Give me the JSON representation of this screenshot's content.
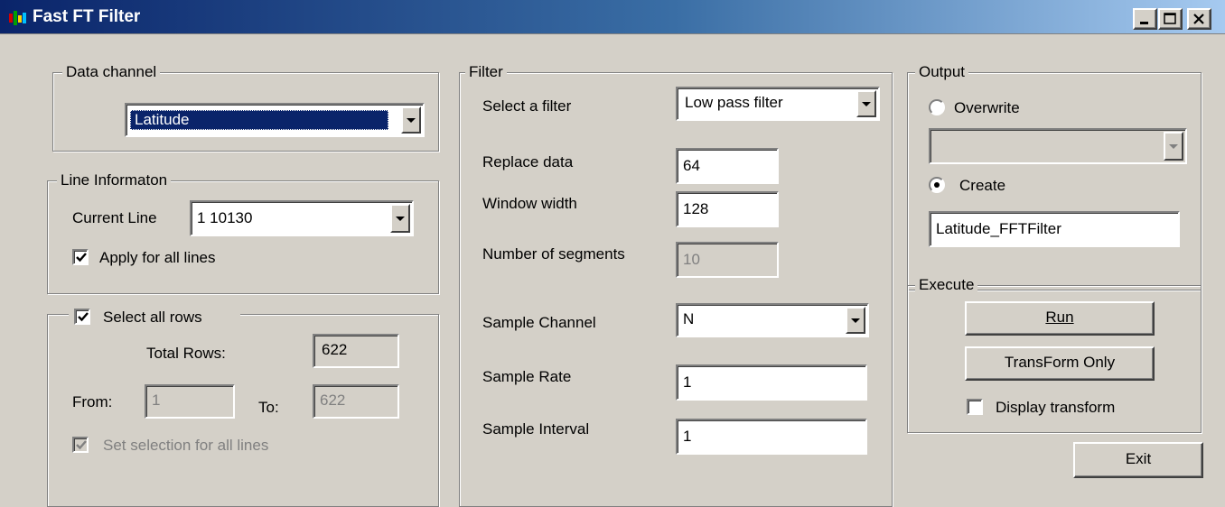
{
  "window": {
    "title": "Fast FT Filter"
  },
  "data_channel": {
    "legend": "Data channel",
    "selected": "Latitude"
  },
  "line_info": {
    "legend": "Line Informaton",
    "current_line_label": "Current Line",
    "current_line_value": "1  10130",
    "apply_all_label": "Apply for all lines"
  },
  "rows": {
    "select_all_label": "Select all rows",
    "total_rows_label": "Total Rows:",
    "total_rows_value": "622",
    "from_label": "From:",
    "from_value": "1",
    "to_label": "To:",
    "to_value": "622",
    "set_selection_label": "Set selection for all lines"
  },
  "filter": {
    "legend": "Filter",
    "select_label": "Select a filter",
    "select_value": "Low pass filter",
    "replace_label": "Replace data",
    "replace_value": "64",
    "window_label": "Window width",
    "window_value": "128",
    "segments_label": "Number of segments",
    "segments_value": "10",
    "sample_channel_label": "Sample Channel",
    "sample_channel_value": "N",
    "sample_rate_label": "Sample Rate",
    "sample_rate_value": "1",
    "sample_interval_label": "Sample Interval",
    "sample_interval_value": "1"
  },
  "output": {
    "legend": "Output",
    "overwrite_label": "Overwrite",
    "overwrite_selected_value": "",
    "create_label": "Create",
    "create_value": "Latitude_FFTFilter",
    "selected_option": "Create"
  },
  "execute": {
    "legend": "Execute",
    "run_label": "Run",
    "transform_label": "TransForm Only",
    "display_label": "Display transform"
  },
  "exit_label": "Exit",
  "states": {
    "apply_all_checked": true,
    "select_all_rows_checked": true,
    "set_selection_checked": true,
    "display_transform_checked": false
  },
  "icons": [
    "app-icon",
    "minimize-icon",
    "maximize-icon",
    "close-icon",
    "chevron-down-icon",
    "checkmark-icon"
  ],
  "colors": {
    "title_bar": "#0a246a",
    "face": "#d4d0c8",
    "selection": "#0a246a"
  }
}
